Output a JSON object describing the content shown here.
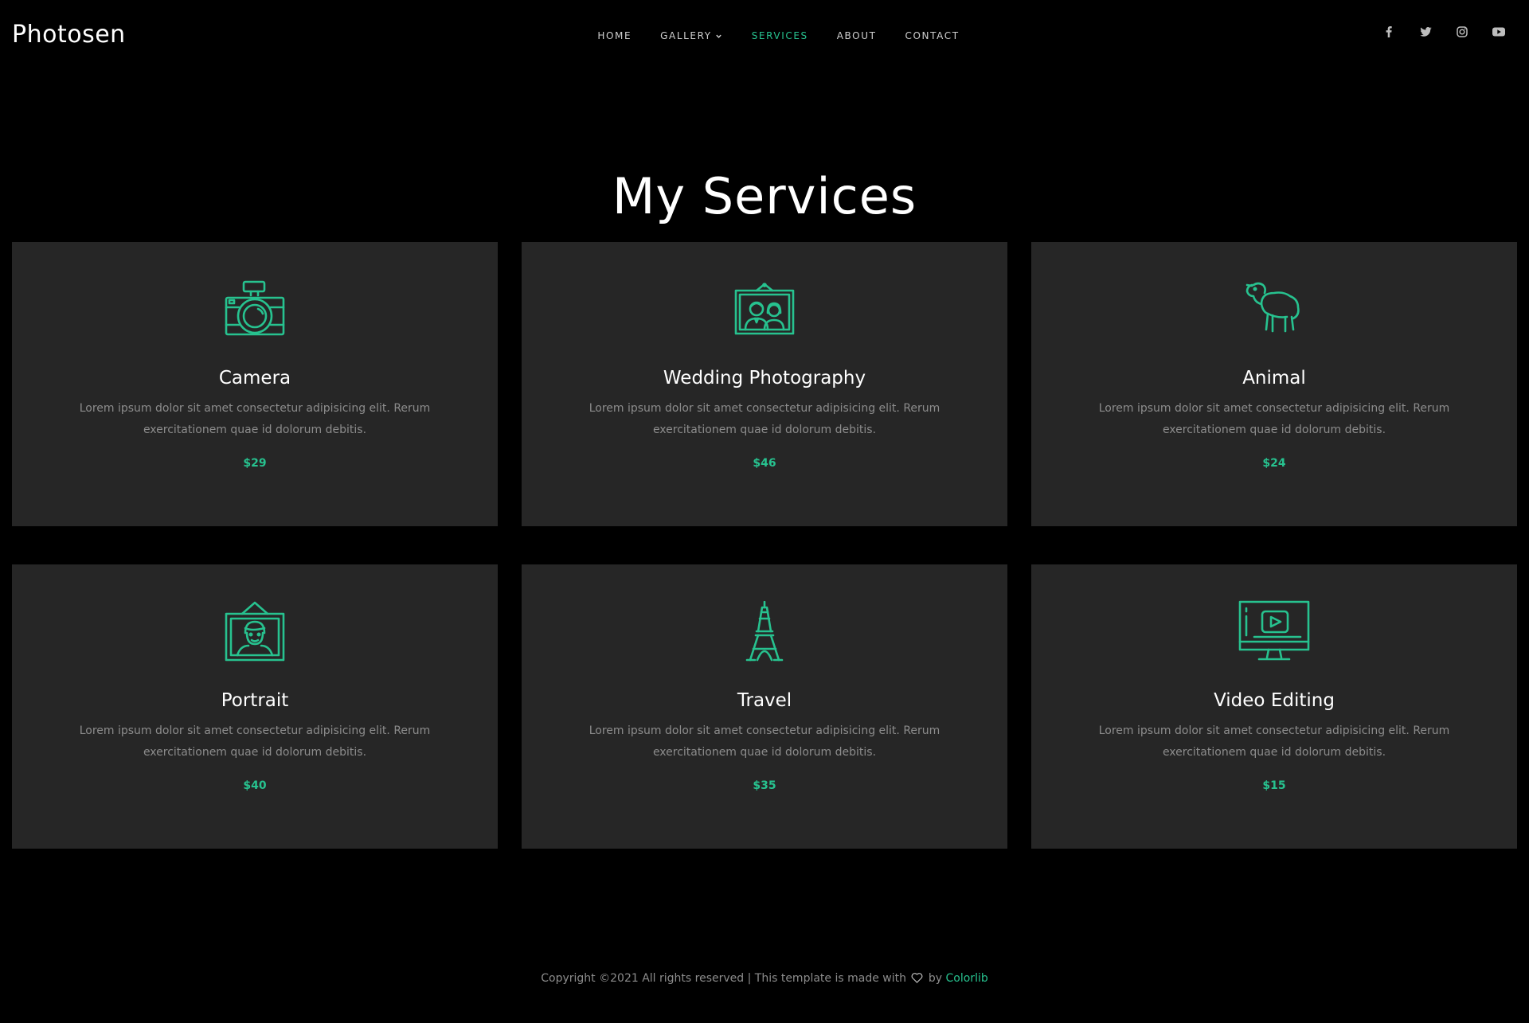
{
  "brand": {
    "name": "Photosen"
  },
  "nav": {
    "items": [
      {
        "label": "HOME",
        "active": false
      },
      {
        "label": "GALLERY",
        "active": false,
        "dropdown": true
      },
      {
        "label": "SERVICES",
        "active": true
      },
      {
        "label": "ABOUT",
        "active": false
      },
      {
        "label": "CONTACT",
        "active": false
      }
    ]
  },
  "social": [
    "facebook-icon",
    "twitter-icon",
    "instagram-icon",
    "youtube-icon"
  ],
  "page": {
    "title": "My Services"
  },
  "services": [
    {
      "icon": "camera-icon",
      "title": "Camera",
      "description": "Lorem ipsum dolor sit amet consectetur adipisicing elit. Rerum exercitationem quae id dolorum debitis.",
      "price": "$29"
    },
    {
      "icon": "wedding-couple-icon",
      "title": "Wedding Photography",
      "description": "Lorem ipsum dolor sit amet consectetur adipisicing elit. Rerum exercitationem quae id dolorum debitis.",
      "price": "$46"
    },
    {
      "icon": "sheep-icon",
      "title": "Animal",
      "description": "Lorem ipsum dolor sit amet consectetur adipisicing elit. Rerum exercitationem quae id dolorum debitis.",
      "price": "$24"
    },
    {
      "icon": "portrait-frame-icon",
      "title": "Portrait",
      "description": "Lorem ipsum dolor sit amet consectetur adipisicing elit. Rerum exercitationem quae id dolorum debitis.",
      "price": "$40"
    },
    {
      "icon": "eiffel-tower-icon",
      "title": "Travel",
      "description": "Lorem ipsum dolor sit amet consectetur adipisicing elit. Rerum exercitationem quae id dolorum debitis.",
      "price": "$35"
    },
    {
      "icon": "video-monitor-icon",
      "title": "Video Editing",
      "description": "Lorem ipsum dolor sit amet consectetur adipisicing elit. Rerum exercitationem quae id dolorum debitis.",
      "price": "$15"
    }
  ],
  "footer": {
    "text_before": "Copyright ©2021 All rights reserved | This template is made with",
    "text_by": "by",
    "link": "Colorlib"
  },
  "colors": {
    "accent": "#27c28f",
    "card_bg": "#262626",
    "page_bg": "#000000"
  }
}
